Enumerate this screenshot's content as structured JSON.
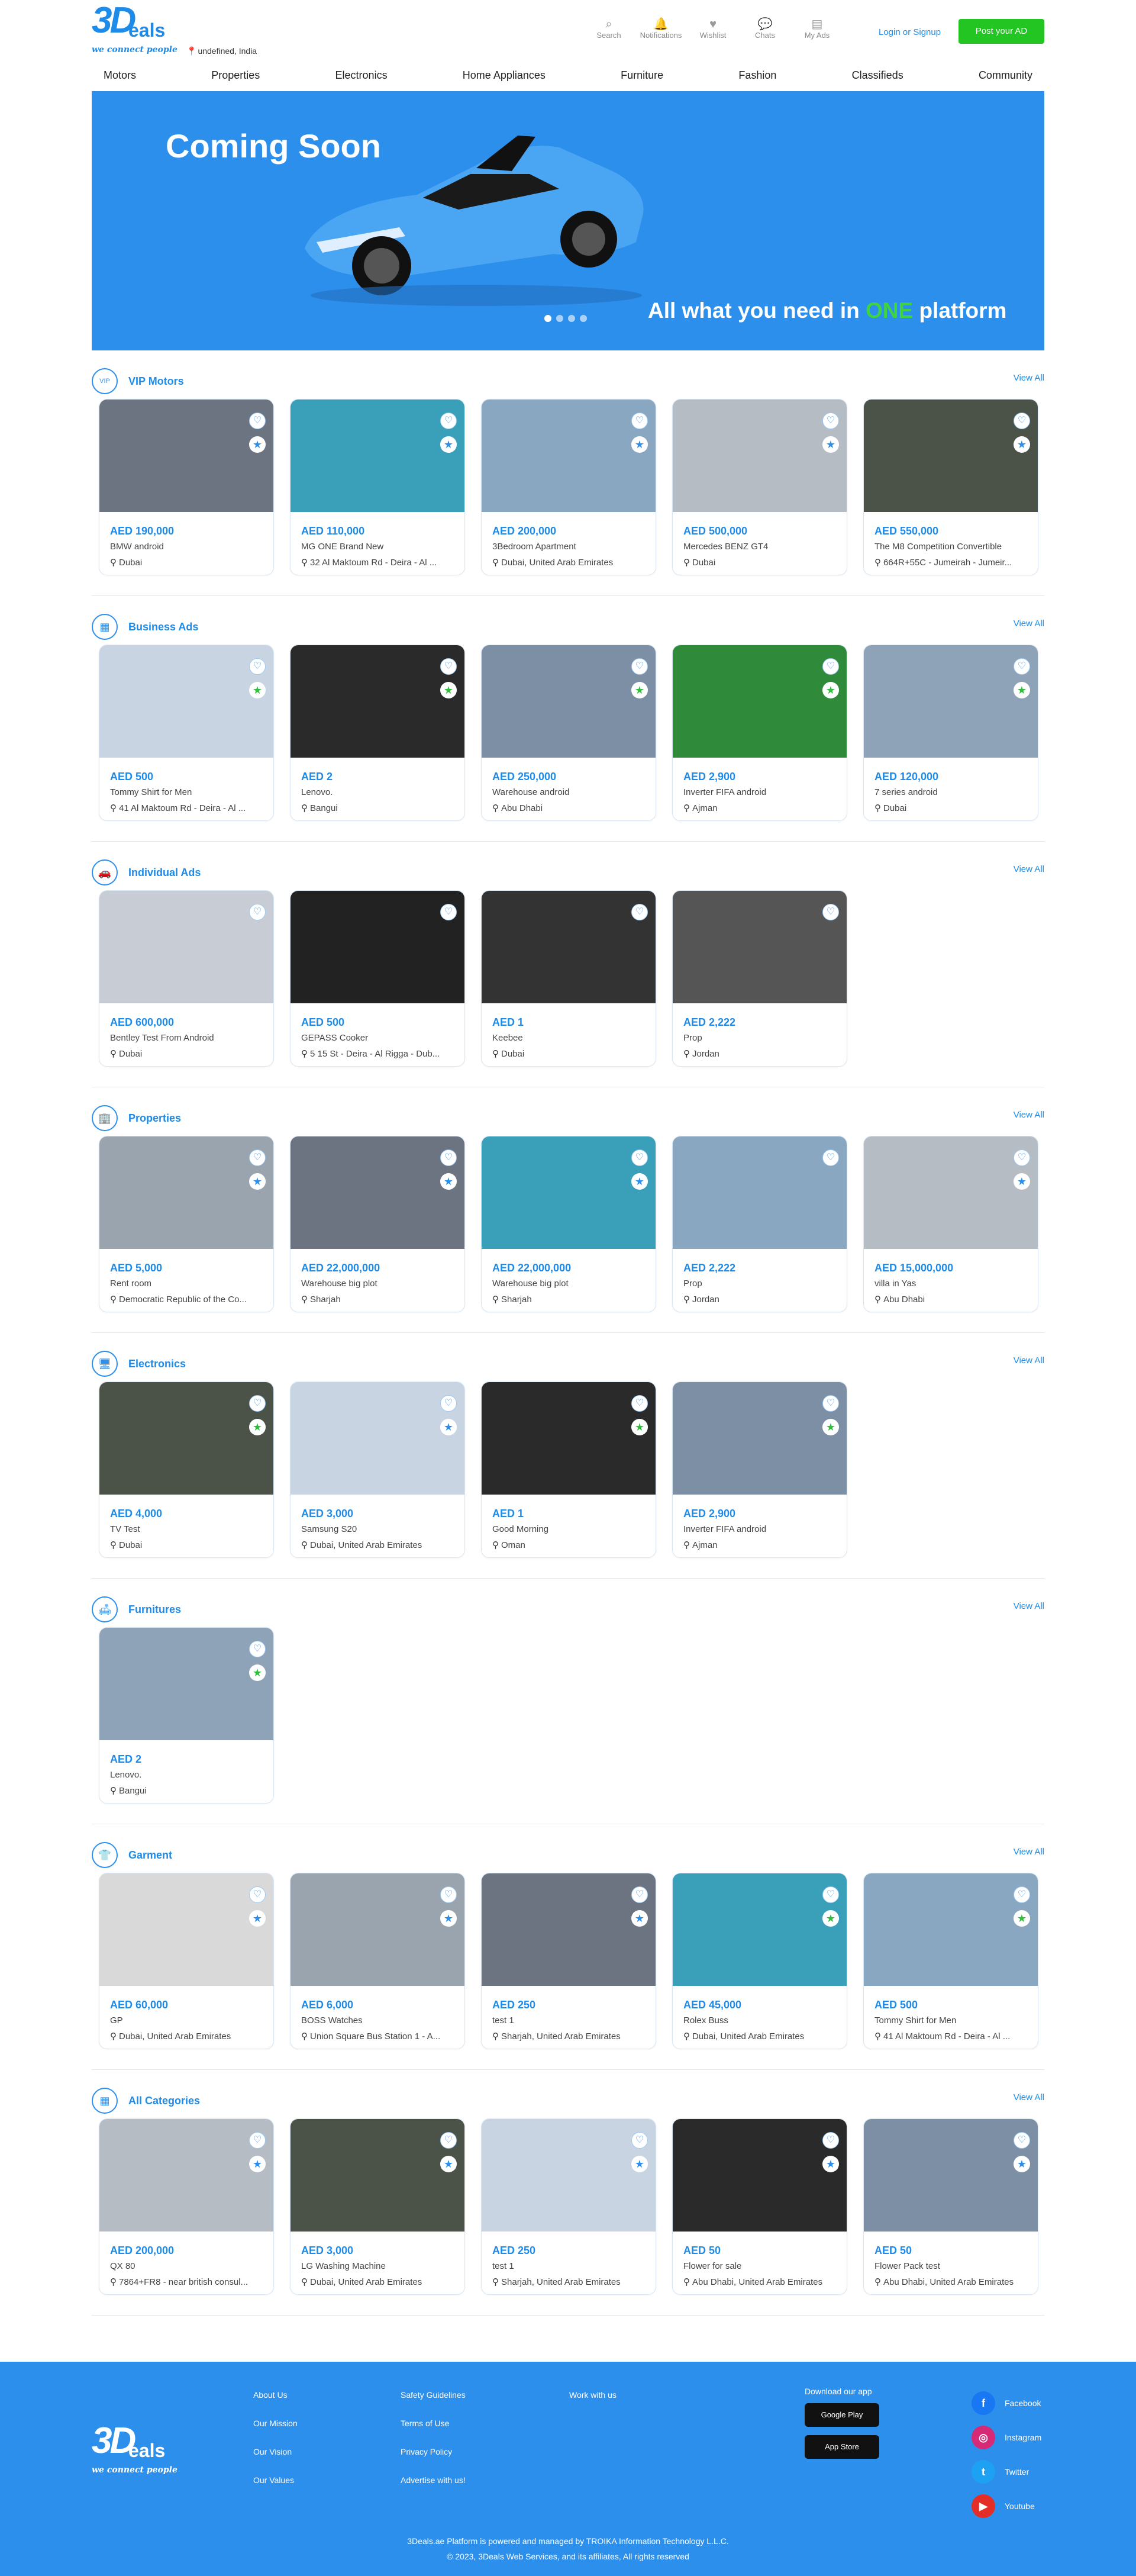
{
  "header": {
    "logo_3d": "3D",
    "logo_deals": "eals",
    "tagline": "we connect people",
    "location": "undefined, India",
    "icons": [
      {
        "label": "Search",
        "icon": "search-icon"
      },
      {
        "label": "Notifications",
        "icon": "bell-icon"
      },
      {
        "label": "Wishlist",
        "icon": "heart-icon"
      },
      {
        "label": "Chats",
        "icon": "chat-icon"
      },
      {
        "label": "My Ads",
        "icon": "document-icon"
      }
    ],
    "login": "Login or Signup",
    "post_ad": "Post your AD"
  },
  "nav": [
    "Motors",
    "Properties",
    "Electronics",
    "Home Appliances",
    "Furniture",
    "Fashion",
    "Classifieds",
    "Community"
  ],
  "banner": {
    "coming_soon": "Coming Soon",
    "tagline_pre": "All what you need in ",
    "tagline_one": "ONE",
    "tagline_post": " platform",
    "slide_count": 4,
    "active_slide": 1
  },
  "sections": [
    {
      "title": "VIP Motors",
      "icon": "vip-icon",
      "view_all": "View All",
      "cards": [
        {
          "price": "AED 190,000",
          "title": "BMW android",
          "location": "Dubai",
          "badge": "blue"
        },
        {
          "price": "AED 110,000",
          "title": "MG ONE Brand New",
          "location": "32 Al Maktoum Rd - Deira - Al ...",
          "badge": "blue"
        },
        {
          "price": "AED 200,000",
          "title": "3Bedroom Apartment",
          "location": "Dubai, United Arab Emirates",
          "badge": "blue"
        },
        {
          "price": "AED 500,000",
          "title": "Mercedes BENZ GT4",
          "location": "Dubai",
          "badge": "blue"
        },
        {
          "price": "AED 550,000",
          "title": "The M8 Competition Convertible",
          "location": "664R+55C - Jumeirah - Jumeir...",
          "badge": "blue"
        }
      ]
    },
    {
      "title": "Business Ads",
      "icon": "business-icon",
      "view_all": "View All",
      "cards": [
        {
          "price": "AED 500",
          "title": "Tommy Shirt for Men",
          "location": "41 Al Maktoum Rd - Deira - Al ...",
          "badge": "green"
        },
        {
          "price": "AED 2",
          "title": "Lenovo.",
          "location": "Bangui",
          "badge": "green"
        },
        {
          "price": "AED 250,000",
          "title": "Warehouse android",
          "location": "Abu Dhabi",
          "badge": "green"
        },
        {
          "price": "AED 2,900",
          "title": "Inverter FIFA android",
          "location": "Ajman",
          "badge": "green"
        },
        {
          "price": "AED 120,000",
          "title": "7 series android",
          "location": "Dubai",
          "badge": "green"
        }
      ]
    },
    {
      "title": "Individual Ads",
      "icon": "car-icon",
      "view_all": "View All",
      "cards": [
        {
          "price": "AED 600,000",
          "title": "Bentley Test From Android",
          "location": "Dubai",
          "badge": "none"
        },
        {
          "price": "AED 500",
          "title": "GEPASS Cooker",
          "location": "5 15 St - Deira - Al Rigga - Dub...",
          "badge": "none"
        },
        {
          "price": "AED 1",
          "title": "Keebee",
          "location": "Dubai",
          "badge": "none"
        },
        {
          "price": "AED 2,222",
          "title": "Prop",
          "location": "Jordan",
          "badge": "none"
        }
      ]
    },
    {
      "title": "Properties",
      "icon": "building-icon",
      "view_all": "View All",
      "cards": [
        {
          "price": "AED 5,000",
          "title": "Rent room",
          "location": "Democratic Republic of the Co...",
          "badge": "blue"
        },
        {
          "price": "AED 22,000,000",
          "title": "Warehouse big plot",
          "location": "Sharjah",
          "badge": "blue"
        },
        {
          "price": "AED 22,000,000",
          "title": "Warehouse big plot",
          "location": "Sharjah",
          "badge": "blue"
        },
        {
          "price": "AED 2,222",
          "title": "Prop",
          "location": "Jordan",
          "badge": "none"
        },
        {
          "price": "AED 15,000,000",
          "title": "villa in Yas",
          "location": "Abu Dhabi",
          "badge": "blue"
        }
      ]
    },
    {
      "title": "Electronics",
      "icon": "electronics-icon",
      "view_all": "View All",
      "cards": [
        {
          "price": "AED 4,000",
          "title": "TV Test",
          "location": "Dubai",
          "badge": "green"
        },
        {
          "price": "AED 3,000",
          "title": "Samsung S20",
          "location": "Dubai, United Arab Emirates",
          "badge": "blue"
        },
        {
          "price": "AED 1",
          "title": "Good Morning",
          "location": "Oman",
          "badge": "green"
        },
        {
          "price": "AED 2,900",
          "title": "Inverter FIFA android",
          "location": "Ajman",
          "badge": "green"
        }
      ]
    },
    {
      "title": "Furnitures",
      "icon": "sofa-icon",
      "view_all": "View All",
      "cards": [
        {
          "price": "AED 2",
          "title": "Lenovo.",
          "location": "Bangui",
          "badge": "green"
        }
      ]
    },
    {
      "title": "Garment",
      "icon": "garment-icon",
      "view_all": "View All",
      "cards": [
        {
          "price": "AED 60,000",
          "title": "GP",
          "location": "Dubai, United Arab Emirates",
          "badge": "blue"
        },
        {
          "price": "AED 6,000",
          "title": "BOSS Watches",
          "location": "Union Square Bus Station 1 - A...",
          "badge": "blue"
        },
        {
          "price": "AED 250",
          "title": "test 1",
          "location": "Sharjah, United Arab Emirates",
          "badge": "blue"
        },
        {
          "price": "AED 45,000",
          "title": "Rolex Buss",
          "location": "Dubai, United Arab Emirates",
          "badge": "green"
        },
        {
          "price": "AED 500",
          "title": "Tommy Shirt for Men",
          "location": "41 Al Maktoum Rd - Deira - Al ...",
          "badge": "green"
        }
      ]
    },
    {
      "title": "All Categories",
      "icon": "grid-icon",
      "view_all": "View All",
      "cards": [
        {
          "price": "AED 200,000",
          "title": "QX 80",
          "location": "7864+FR8 - near british consul...",
          "badge": "blue"
        },
        {
          "price": "AED 3,000",
          "title": "LG Washing Machine",
          "location": "Dubai, United Arab Emirates",
          "badge": "blue"
        },
        {
          "price": "AED 250",
          "title": "test 1",
          "location": "Sharjah, United Arab Emirates",
          "badge": "blue"
        },
        {
          "price": "AED 50",
          "title": "Flower for sale",
          "location": "Abu Dhabi, United Arab Emirates",
          "badge": "blue"
        },
        {
          "price": "AED 50",
          "title": "Flower Pack test",
          "location": "Abu Dhabi, United Arab Emirates",
          "badge": "blue"
        }
      ]
    }
  ],
  "footer": {
    "col1": [
      "About Us",
      "Our Mission",
      "Our Vision",
      "Our Values"
    ],
    "col2": [
      "Safety Guidelines",
      "Terms of Use",
      "Privacy Policy",
      "Advertise with us!"
    ],
    "col3": [
      "Work with us"
    ],
    "download_title": "Download our app",
    "google_play": "Google Play",
    "app_store": "App Store",
    "social": [
      {
        "label": "Facebook",
        "icon": "facebook-icon",
        "color": "#1877f2"
      },
      {
        "label": "Instagram",
        "icon": "instagram-icon",
        "color": "#d62976"
      },
      {
        "label": "Twitter",
        "icon": "twitter-icon",
        "color": "#1da1f2"
      },
      {
        "label": "Youtube",
        "icon": "youtube-icon",
        "color": "#e52d27"
      }
    ],
    "powered": "3Deals.ae Platform is powered and managed by TROIKA Information Technology L.L.C.",
    "copyright": "© 2023, 3Deals Web Services, and its affiliates, All rights reserved"
  },
  "colors": {
    "primary": "#2d8fec",
    "accent": "#22c522"
  }
}
